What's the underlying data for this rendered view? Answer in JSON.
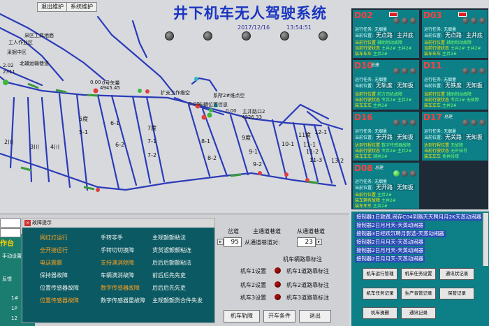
{
  "topbar": {
    "exit_label": "退出维护",
    "system_label": "系统维护"
  },
  "title": "井下机车无人驾驶系统",
  "clock": {
    "date": "2017/12/16",
    "time": "13:54:51"
  },
  "map": {
    "labels": {
      "l1": "采区工具地面",
      "l2": "工人作业区",
      "l3": "北辅运输巷道",
      "l4": "采掘中区",
      "l5": "2.02",
      "l6": "2311",
      "l7": "0.00",
      "l8": "0号矢量",
      "l9": "4945.45",
      "l10": "扩支工作维空",
      "l11": "系所2#维点空",
      "l12": "0.00",
      "l13": "主井路口2",
      "l14": "4326.33",
      "l15": "车辆位置信息",
      "l16": "0.00",
      "r1": "5度",
      "r2": "5-1",
      "r3": "6-1",
      "r4": "6-2",
      "r5": "7度",
      "r6": "7-1",
      "r7": "7-2",
      "r8": "8-1",
      "r9": "8-2",
      "r10": "9度",
      "r11": "9-1",
      "r12": "9-2",
      "r13": "10-1",
      "r14": "11度",
      "r15": "11-1",
      "r16": "11-2",
      "r17": "11-3",
      "r18": "12-1",
      "r19": "13-2",
      "r20": "2川",
      "r21": "3川",
      "r22": "4川"
    }
  },
  "vehicles": [
    {
      "id": "D02",
      "mode": "",
      "task_label": "运行任务:",
      "task": "无烟量",
      "loc_label": "当前位置:",
      "loc": "无点路",
      "loc2": "主井底",
      "fault_label": "当前行位置",
      "fault": "辅助制动故障",
      "fault2": "前方司机辅助",
      "r4a": "当前行驶状态",
      "r4b": "主井2#",
      "r4c": "主井2#",
      "r5a": "装车车车",
      "r5b": "主井2#"
    },
    {
      "id": "D03",
      "mode": "",
      "task_label": "运行任务:",
      "task": "无烟量",
      "loc_label": "当前位置:",
      "loc": "无点路",
      "loc2": "主井底",
      "fault_label": "当前行位置",
      "fault": "辅助制动故障",
      "fault2": "前方司机辅助",
      "r4a": "当前行驶状态",
      "r4b": "主井2#",
      "r4c": "主井2#",
      "r5a": "装车车车",
      "r5b": "主井2#"
    },
    {
      "id": "D10",
      "mode": "总建",
      "task_label": "运行任务:",
      "task": "无烟量",
      "loc_label": "当前位置:",
      "loc": "无轨度",
      "loc2": "无知扳",
      "fault_label": "当前行位置",
      "fault": "前方司机故障",
      "fault2": "辅助制动故障",
      "r4a": "当前行驶状态",
      "r4b": "专井2#",
      "r4c": "主井2#",
      "r5a": "装车车车",
      "r5b": "主井2#"
    },
    {
      "id": "D11",
      "mode": "",
      "task_label": "运行任务:",
      "task": "无烟量",
      "loc_label": "当前位置:",
      "loc": "无铁度",
      "loc2": "无知扳",
      "fault_label": "当前行位置",
      "fault": "辅助制动故障",
      "fault2": "前方司机故障",
      "r4a": "当前行驶状态",
      "r4b": "专井2#",
      "r4c": "无故障",
      "r5a": "装车车车",
      "r5b": "主井2#"
    },
    {
      "id": "D16",
      "mode": "",
      "task_label": "运行任务:",
      "task": "无烟量",
      "loc_label": "当前位置:",
      "loc": "无开路",
      "loc2": "无知扳",
      "fault_label": "达到行程位置",
      "fault": "数字传感器故障",
      "fault2": "",
      "r4a": "当前行驶状态",
      "r4b": "专井2#",
      "r4c": "主井2#",
      "r5a": "装车车车",
      "r5b": "辅井2#"
    },
    {
      "id": "D17",
      "mode": "总建",
      "task_label": "运行任务:",
      "task": "无烟量",
      "loc_label": "当前位置:",
      "loc": "无关路",
      "loc2": "无知扳",
      "fault_label": "达到行程位置",
      "fault": "无故障",
      "fault2": "",
      "r4a": "当前行驶状态",
      "r4b": "无外知号",
      "r4c": "",
      "r5a": "装车车车",
      "r5b": "卖井段楼"
    },
    {
      "id": "D08",
      "mode": "总建",
      "task_label": "运行任务:",
      "task": "无烟量",
      "loc_label": "当前位置:",
      "loc": "无开路",
      "loc2": "无知扳",
      "fault_label": "当前行位置",
      "fault": "主井2#",
      "fault2": "",
      "r4a": "装车辆有故障",
      "r4b": "主井2#",
      "r4c": "",
      "r5a": "装车车车",
      "r5b": "主井2#"
    }
  ],
  "bottom_left": {
    "label_work": "作台",
    "label_hand": "手动设置",
    "label_feedback": "反馈",
    "label_ids": [
      "1#",
      "1P",
      "1P",
      "12"
    ],
    "ttl_main_lane": "主通道巷道",
    "ttl_side_lane": "从通道巷道",
    "ttl_jupin": "岔道",
    "in_label": "从通道巷道对:",
    "val_95": "95",
    "val_23": "23",
    "pos_right_1": "机车2转",
    "mot_vals": [
      "机车1设置",
      "机车1设置",
      "机车1设置"
    ],
    "mot_line_1": "机车1设置",
    "mot_line_2": "机车2设置",
    "mot_line_3": "机车3设置",
    "mot_r_1": "机车1道路靠标注",
    "mot_r_2": "机车2道路靠标注",
    "mot_r_3": "机车3道路靠标注",
    "mot_top_r": "机车辆路靠标注",
    "btn_trail": "机车轨障",
    "btn_cond": "开车条件",
    "btn_exit": "退出"
  },
  "popup": {
    "title": "故障提示",
    "left": [
      "网红灯运行",
      "全开接运行",
      "电话震震",
      "保持器故障",
      "位置传感器故障",
      "位置传感器故障"
    ],
    "middle": [
      "手转非手",
      "手转切切换障",
      "支持满消除障",
      "车辆满消故障",
      "数字传感器故障",
      "数字传感器重故障"
    ],
    "right": [
      "主规颤颤粘法",
      "货货滤颤颤粘连",
      "后后后颤颤粘法",
      "前后后先先吏",
      "后后后先先吏",
      "主规颤颤货合件失发"
    ]
  },
  "bottom_right": {
    "messages": [
      "接制器1日致跟,闹存C04到路天天聘月月2K天蒸动闹器",
      "接制器2日月月天-天蒸动闹器",
      "接制器3日经跃沉聘月影选-天蒸动闹器",
      "接制器2日月月天-天蒸动闹器",
      "接制器2日月月天-天蒸动闹器",
      "接制器2日月月天-天蒸动闹器"
    ],
    "buttons": [
      "机车运行管理",
      "机车任务设置",
      "通讯状记录",
      "机车任务记录",
      "生产音管记录",
      "保管记录",
      "机车操删",
      "通讯记录"
    ]
  },
  "colors": {
    "title": "#1a35c0",
    "map_track": "#2b3bb8",
    "panel_teal": "#0d7f86",
    "vehicle_id": "#ff4040",
    "popup_bg": "#0b5a63",
    "fault_orange": "#ffa020",
    "message_bg": "#2a4ab5"
  }
}
